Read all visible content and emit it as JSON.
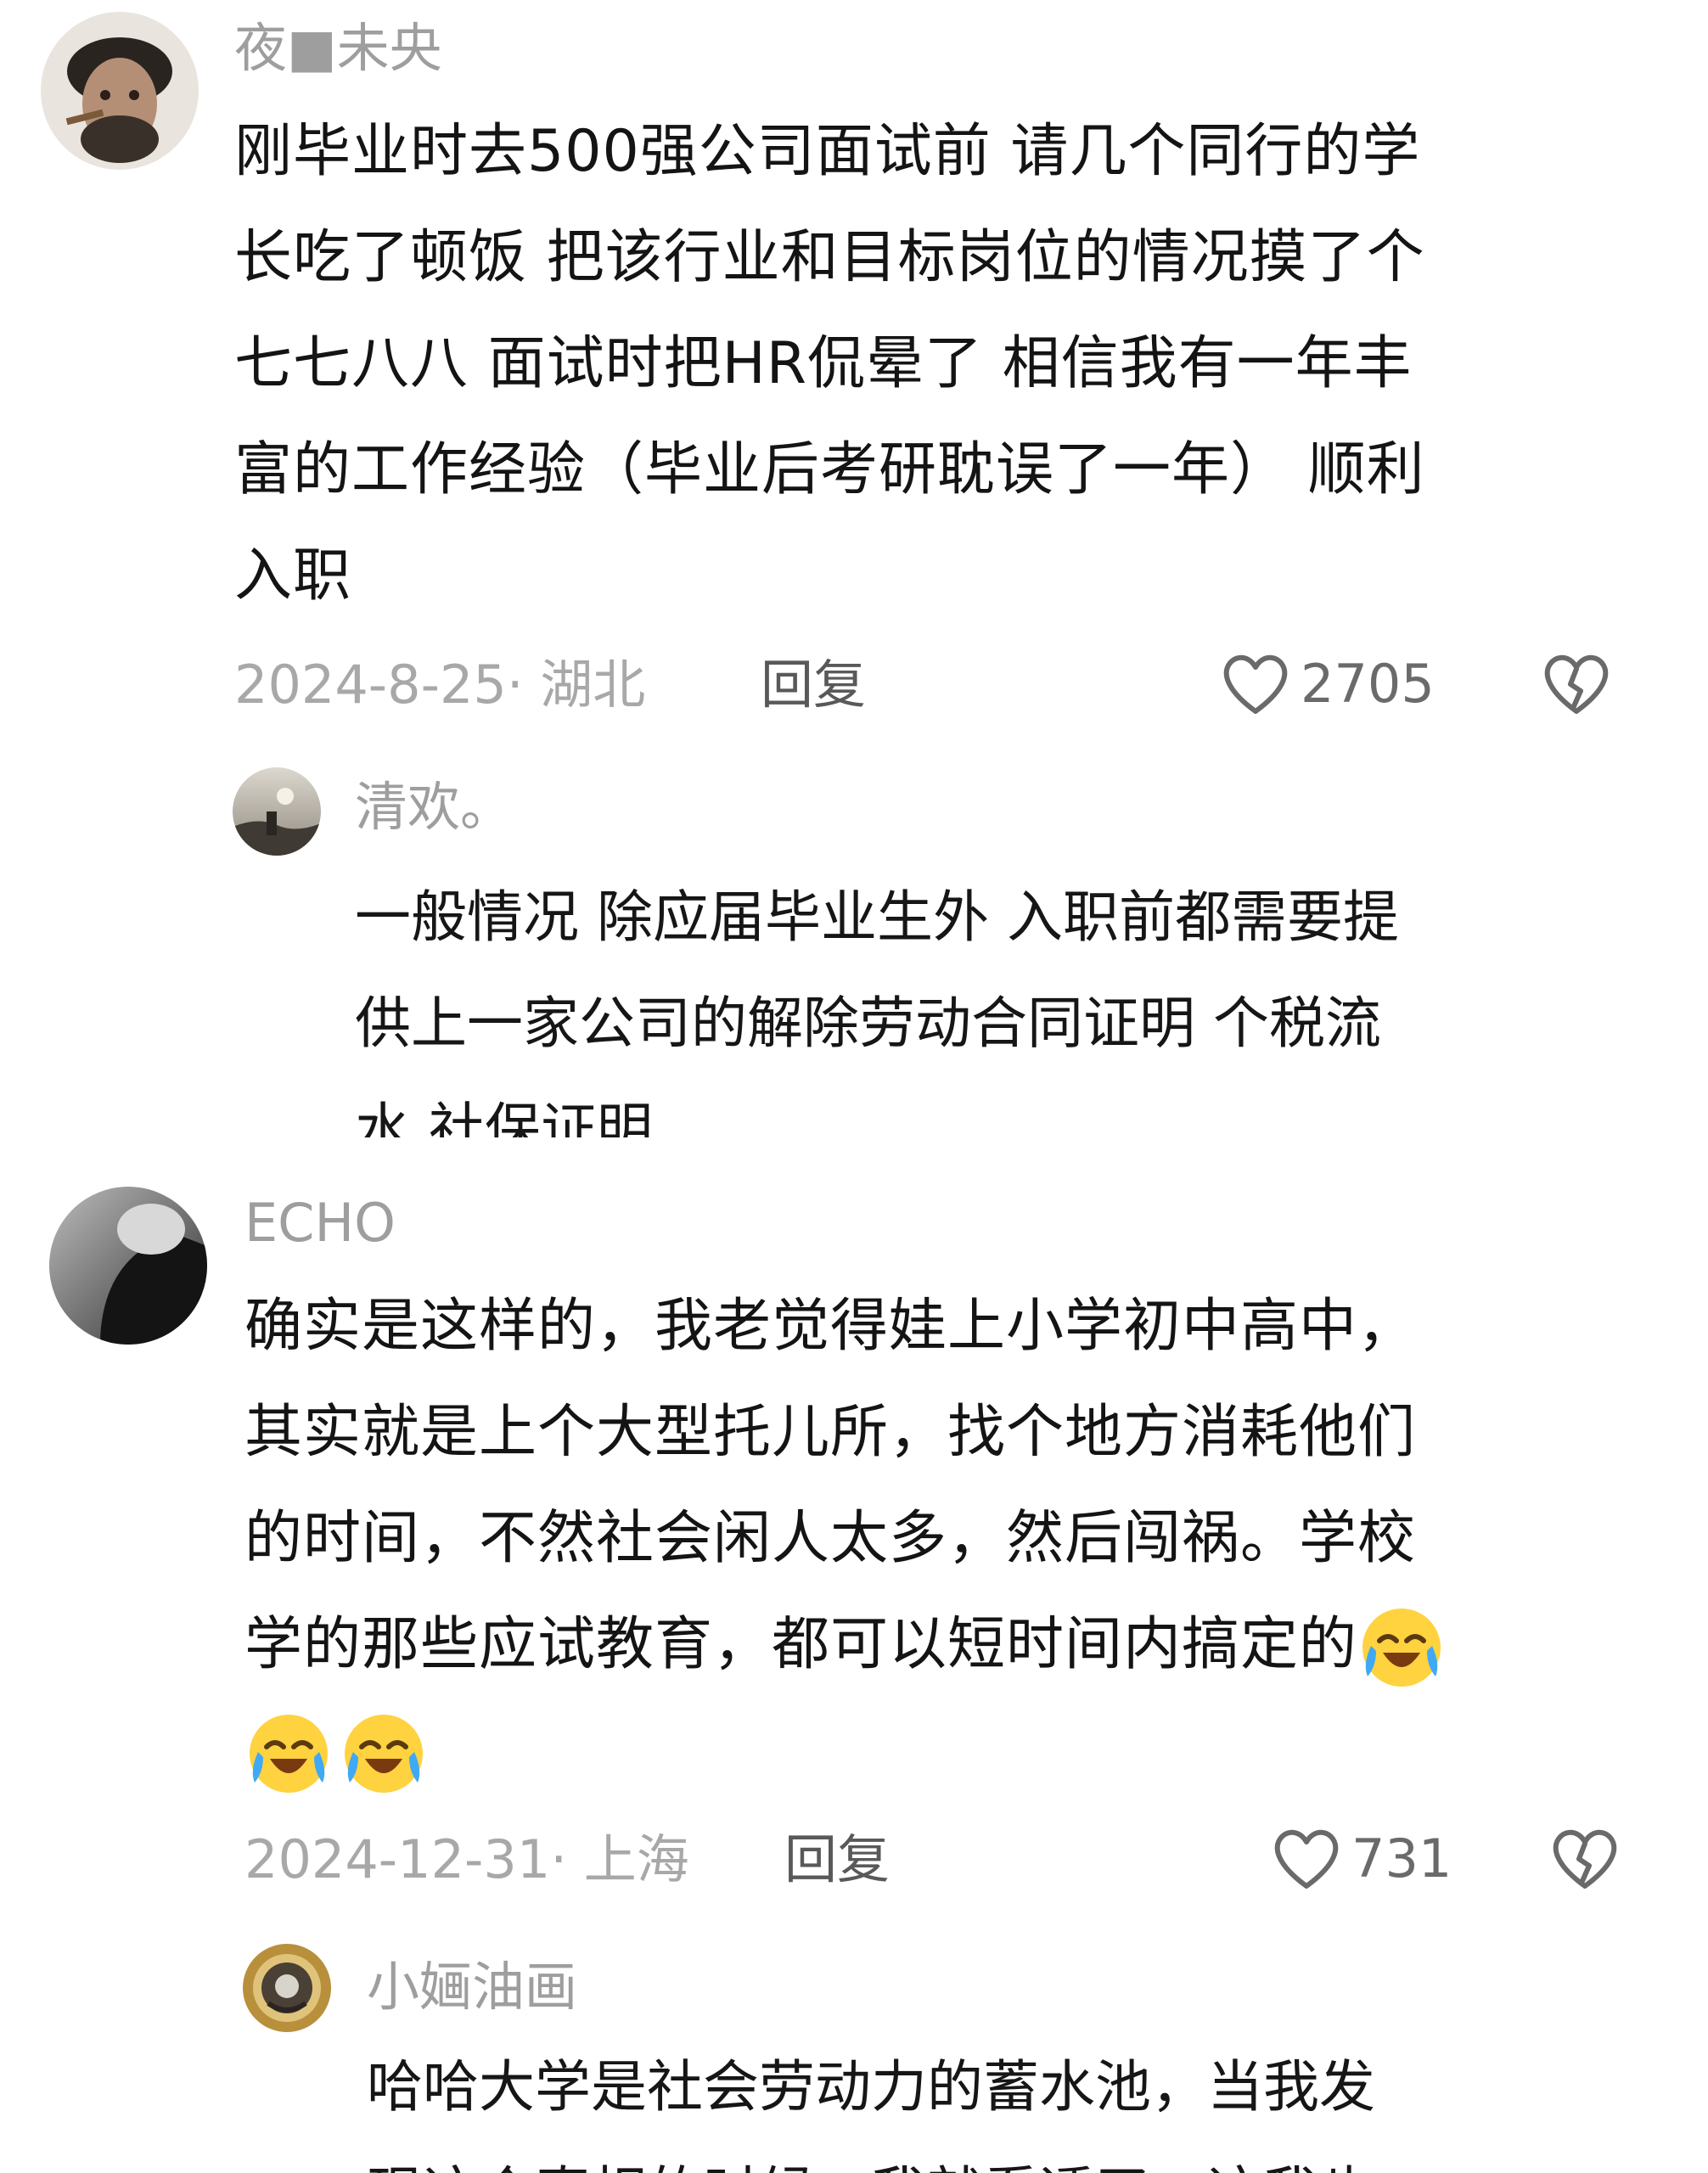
{
  "comments": [
    {
      "username": "夜■未央",
      "content_lines": [
        "刚毕业时去500强公司面试前  请几个同行的学",
        "长吃了顿饭  把该行业和目标岗位的情况摸了个",
        "七七八八  面试时把HR侃晕了 相信我有一年丰",
        "富的工作经验（毕业后考研耽误了一年） 顺利",
        "入职"
      ],
      "date": "2024-8-25· 湖北",
      "reply_label": "回复",
      "likes": "2705",
      "reply": {
        "username": "清欢。",
        "content_lines": [
          "一般情况 除应届毕业生外 入职前都需要提",
          "供上一家公司的解除劳动合同证明 个税流",
          "水 社保证明"
        ]
      }
    },
    {
      "username": "ECHO",
      "content_lines": [
        "确实是这样的，我老觉得娃上小学初中高中，",
        "其实就是上个大型托儿所，找个地方消耗他们",
        "的时间，不然社会闲人太多，然后闯祸。学校",
        "学的那些应试教育，都可以短时间内搞定的"
      ],
      "emoji_name": "crying-laughing-emoji",
      "date": "2024-12-31· 上海",
      "reply_label": "回复",
      "likes": "731",
      "reply": {
        "username": "小婳油画",
        "content_lines": [
          "哈哈大学是社会劳动力的蓄水池，当我发",
          "现这个真相的时候，我就看透了，这我也"
        ]
      }
    }
  ],
  "colors": {
    "username": "#9e9e9e",
    "text": "#141414",
    "meta": "#a8a8a8",
    "reply_button": "#595959"
  }
}
